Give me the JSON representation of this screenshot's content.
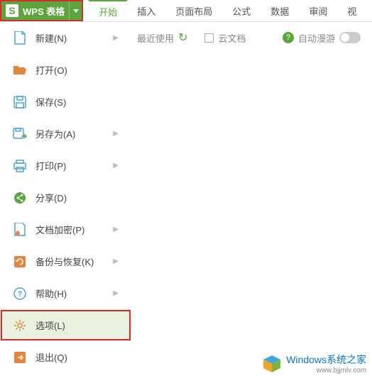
{
  "header": {
    "appName": "WPS 表格",
    "logoLetter": "S"
  },
  "tabs": [
    {
      "label": "开始",
      "active": true
    },
    {
      "label": "插入",
      "active": false
    },
    {
      "label": "页面布局",
      "active": false
    },
    {
      "label": "公式",
      "active": false
    },
    {
      "label": "数据",
      "active": false
    },
    {
      "label": "审阅",
      "active": false
    },
    {
      "label": "视",
      "active": false
    }
  ],
  "sidebar": {
    "items": [
      {
        "label": "新建(N)",
        "iconColor": "#4aa3df",
        "hasArrow": true,
        "highlighted": false,
        "boxed": false
      },
      {
        "label": "打开(O)",
        "iconColor": "#e8833a",
        "hasArrow": false,
        "highlighted": false,
        "boxed": false
      },
      {
        "label": "保存(S)",
        "iconColor": "#4aa3df",
        "hasArrow": false,
        "highlighted": false,
        "boxed": false
      },
      {
        "label": "另存为(A)",
        "iconColor": "#4aa3df",
        "hasArrow": true,
        "highlighted": false,
        "boxed": false
      },
      {
        "label": "打印(P)",
        "iconColor": "#4aa3df",
        "hasArrow": true,
        "highlighted": false,
        "boxed": false
      },
      {
        "label": "分享(D)",
        "iconColor": "#5aa63c",
        "hasArrow": false,
        "highlighted": false,
        "boxed": false
      },
      {
        "label": "文档加密(P)",
        "iconColor": "#4aa3df",
        "hasArrow": true,
        "highlighted": false,
        "boxed": false
      },
      {
        "label": "备份与恢复(K)",
        "iconColor": "#e8833a",
        "hasArrow": true,
        "highlighted": false,
        "boxed": false
      },
      {
        "label": "帮助(H)",
        "iconColor": "#4aa3df",
        "hasArrow": true,
        "highlighted": false,
        "boxed": false
      },
      {
        "label": "选项(L)",
        "iconColor": "#e8833a",
        "hasArrow": false,
        "highlighted": true,
        "boxed": true
      },
      {
        "label": "退出(Q)",
        "iconColor": "#e8833a",
        "hasArrow": false,
        "highlighted": false,
        "boxed": false
      }
    ]
  },
  "content": {
    "recentLabel": "最近使用",
    "cloudLabel": "云文档",
    "autoRoamLabel": "自动漫游"
  },
  "watermark": {
    "main": "Windows系统之家",
    "sub": "www.bjjmlv.com"
  }
}
